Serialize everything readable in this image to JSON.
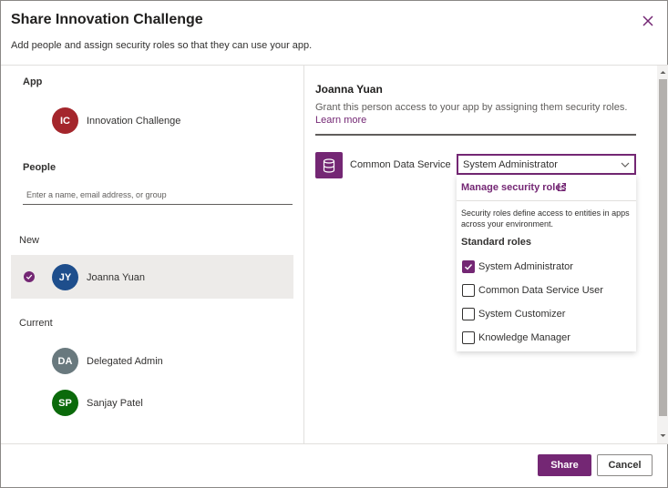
{
  "dialog": {
    "title": "Share Innovation Challenge",
    "subtitle": "Add people and assign security roles so that they can use your app.",
    "close_icon": "close-icon"
  },
  "left": {
    "app_label": "App",
    "app": {
      "initials": "IC",
      "name": "Innovation Challenge",
      "color": "#a4262c"
    },
    "people_label": "People",
    "people_placeholder": "Enter a name, email address, or group",
    "new_label": "New",
    "new_people": [
      {
        "initials": "JY",
        "name": "Joanna Yuan",
        "color": "#1e4e8c",
        "selected": true
      }
    ],
    "current_label": "Current",
    "current_people": [
      {
        "initials": "DA",
        "name": "Delegated Admin",
        "color": "#69797e"
      },
      {
        "initials": "SP",
        "name": "Sanjay Patel",
        "color": "#0b6a0b"
      }
    ]
  },
  "right": {
    "person_name": "Joanna Yuan",
    "grant_text": "Grant this person access to your app by assigning them security roles.",
    "learn_more": "Learn more",
    "service_label": "Common Data Service",
    "service_icon": "database-icon",
    "dropdown_value": "System Administrator",
    "manage_link": "Manage security roles",
    "roles_description": "Security roles define access to entities in apps across your environment.",
    "standard_roles_label": "Standard roles",
    "roles": [
      {
        "label": "System Administrator",
        "checked": true
      },
      {
        "label": "Common Data Service User",
        "checked": false
      },
      {
        "label": "System Customizer",
        "checked": false
      },
      {
        "label": "Knowledge Manager",
        "checked": false
      }
    ]
  },
  "footer": {
    "share_label": "Share",
    "cancel_label": "Cancel"
  },
  "colors": {
    "accent": "#742774",
    "selected_row": "#edebe9"
  }
}
